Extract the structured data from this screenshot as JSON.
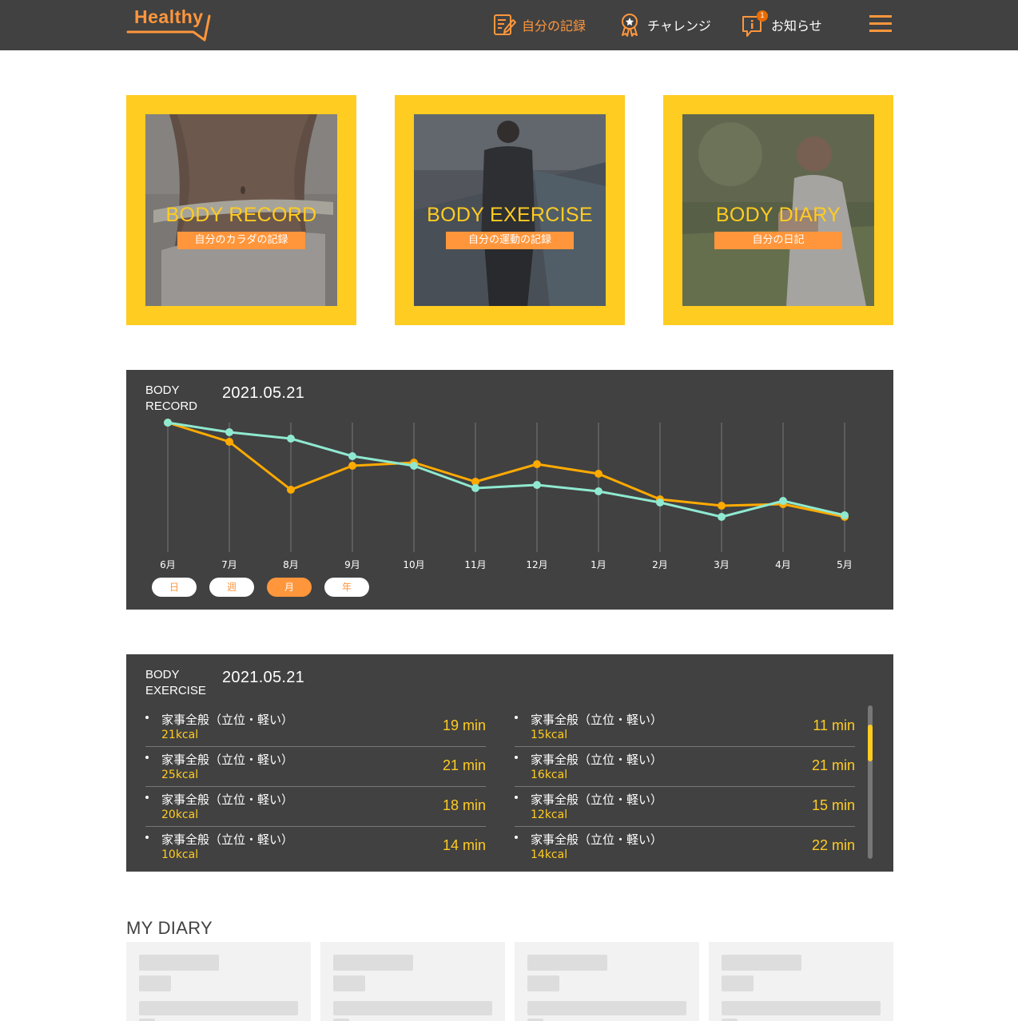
{
  "header": {
    "logo_text": "Healthy",
    "nav": [
      {
        "label": "自分の記録",
        "icon": "memo-icon",
        "active": true
      },
      {
        "label": "チャレンジ",
        "icon": "medal-icon",
        "active": false
      },
      {
        "label": "お知らせ",
        "icon": "info-chat-icon",
        "active": false,
        "badge": "1"
      }
    ],
    "menu_icon": "hamburger-menu-icon"
  },
  "colors": {
    "header_bg": "#414141",
    "accent_orange": "#ff963c",
    "accent_yellow": "#ffcc21",
    "line_series_1": "#ffaa00",
    "line_series_2": "#8fe9d0"
  },
  "cards": [
    {
      "title": "BODY RECORD",
      "subtitle": "自分のカラダの記録"
    },
    {
      "title": "BODY EXERCISE",
      "subtitle": "自分の運動の記録"
    },
    {
      "title": "BODY DIARY",
      "subtitle": "自分の日記"
    }
  ],
  "body_record": {
    "label": "BODY RECORD",
    "date": "2021.05.21",
    "ranges": [
      {
        "label": "日",
        "active": false
      },
      {
        "label": "週",
        "active": false
      },
      {
        "label": "月",
        "active": true
      },
      {
        "label": "年",
        "active": false
      }
    ]
  },
  "chart_data": {
    "type": "line",
    "categories": [
      "6月",
      "7月",
      "8月",
      "9月",
      "10月",
      "11月",
      "12月",
      "1月",
      "2月",
      "3月",
      "4月",
      "5月"
    ],
    "series": [
      {
        "color": "#ffaa00",
        "values": [
          100,
          88,
          58,
          73,
          75,
          63,
          74,
          68,
          52,
          48,
          49,
          41
        ]
      },
      {
        "color": "#8fe9d0",
        "values": [
          100,
          94,
          90,
          79,
          73,
          59,
          61,
          57,
          50,
          41,
          51,
          42
        ]
      }
    ],
    "ylim": [
      40,
      100
    ],
    "grid": "vertical",
    "legend": "none"
  },
  "body_exercise": {
    "label": "BODY EXERCISE",
    "date": "2021.05.21",
    "left_items": [
      {
        "name": "家事全般（立位・軽い）",
        "kcal": "21kcal",
        "minutes": "19 min"
      },
      {
        "name": "家事全般（立位・軽い）",
        "kcal": "25kcal",
        "minutes": "21 min"
      },
      {
        "name": "家事全般（立位・軽い）",
        "kcal": "20kcal",
        "minutes": "18 min"
      },
      {
        "name": "家事全般（立位・軽い）",
        "kcal": "10kcal",
        "minutes": "14 min"
      }
    ],
    "right_items": [
      {
        "name": "家事全般（立位・軽い）",
        "kcal": "15kcal",
        "minutes": "11 min"
      },
      {
        "name": "家事全般（立位・軽い）",
        "kcal": "16kcal",
        "minutes": "21 min"
      },
      {
        "name": "家事全般（立位・軽い）",
        "kcal": "12kcal",
        "minutes": "15 min"
      },
      {
        "name": "家事全般（立位・軽い）",
        "kcal": "14kcal",
        "minutes": "22 min"
      }
    ]
  },
  "diary": {
    "heading": "MY DIARY"
  }
}
